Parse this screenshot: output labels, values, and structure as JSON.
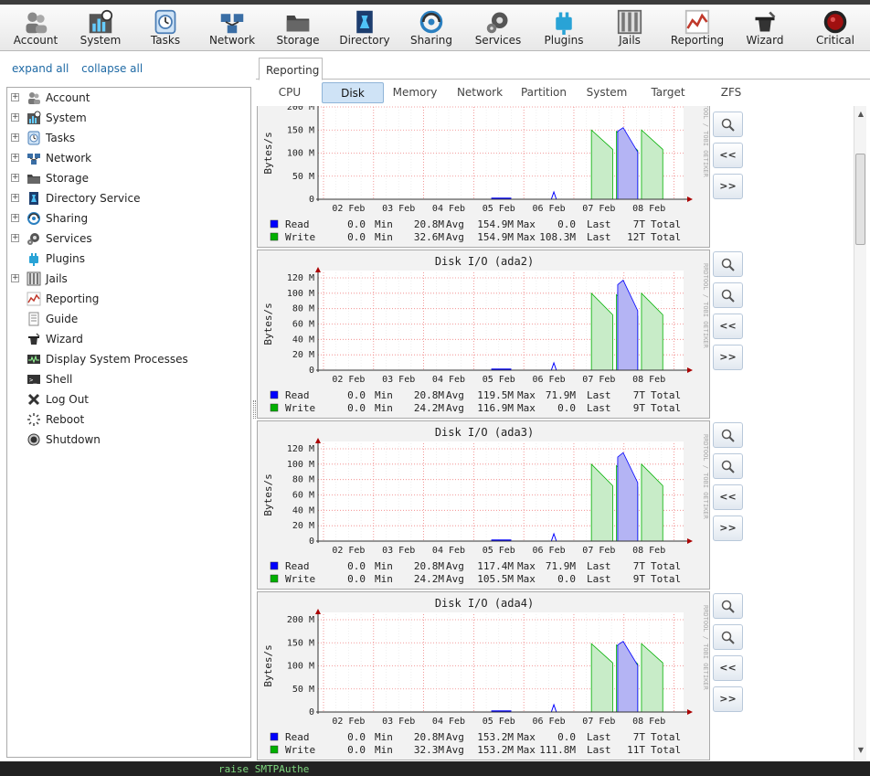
{
  "toolbar": {
    "items": [
      {
        "label": "Account",
        "icon": "users-icon"
      },
      {
        "label": "System",
        "icon": "system-icon"
      },
      {
        "label": "Tasks",
        "icon": "tasks-icon"
      },
      {
        "label": "Network",
        "icon": "network-icon"
      },
      {
        "label": "Storage",
        "icon": "storage-icon"
      },
      {
        "label": "Directory",
        "icon": "directory-icon"
      },
      {
        "label": "Sharing",
        "icon": "sharing-icon"
      },
      {
        "label": "Services",
        "icon": "services-icon"
      },
      {
        "label": "Plugins",
        "icon": "plugins-icon"
      },
      {
        "label": "Jails",
        "icon": "jails-icon"
      },
      {
        "label": "Reporting",
        "icon": "reporting-icon"
      },
      {
        "label": "Wizard",
        "icon": "wizard-icon"
      },
      {
        "label": "Critical",
        "icon": "alert-icon"
      }
    ]
  },
  "tree_controls": {
    "expand": "expand all",
    "collapse": "collapse all"
  },
  "tree": {
    "items": [
      {
        "label": "Account",
        "expandable": true,
        "icon": "users-icon"
      },
      {
        "label": "System",
        "expandable": true,
        "icon": "system-icon"
      },
      {
        "label": "Tasks",
        "expandable": true,
        "icon": "tasks-icon"
      },
      {
        "label": "Network",
        "expandable": true,
        "icon": "network-icon"
      },
      {
        "label": "Storage",
        "expandable": true,
        "icon": "storage-icon"
      },
      {
        "label": "Directory Service",
        "expandable": true,
        "icon": "directory-icon"
      },
      {
        "label": "Sharing",
        "expandable": true,
        "icon": "sharing-icon"
      },
      {
        "label": "Services",
        "expandable": true,
        "icon": "services-icon"
      },
      {
        "label": "Plugins",
        "expandable": false,
        "icon": "plugins-icon"
      },
      {
        "label": "Jails",
        "expandable": true,
        "icon": "jails-icon"
      },
      {
        "label": "Reporting",
        "expandable": false,
        "icon": "reporting-icon"
      },
      {
        "label": "Guide",
        "expandable": false,
        "icon": "guide-icon"
      },
      {
        "label": "Wizard",
        "expandable": false,
        "icon": "wizard-icon"
      },
      {
        "label": "Display System Processes",
        "expandable": false,
        "icon": "processes-icon"
      },
      {
        "label": "Shell",
        "expandable": false,
        "icon": "shell-icon"
      },
      {
        "label": "Log Out",
        "expandable": false,
        "icon": "logout-icon"
      },
      {
        "label": "Reboot",
        "expandable": false,
        "icon": "reboot-icon"
      },
      {
        "label": "Shutdown",
        "expandable": false,
        "icon": "shutdown-icon"
      }
    ]
  },
  "main_tab": "Reporting",
  "subtabs": [
    "CPU",
    "Disk",
    "Memory",
    "Network",
    "Partition",
    "System",
    "Target",
    "ZFS"
  ],
  "active_subtab": "Disk",
  "nav_buttons": {
    "zoom_in": "+",
    "zoom_out": "−",
    "back": "<<",
    "forward": ">>"
  },
  "status": {
    "text": "raise SMTPAuthe"
  },
  "colors": {
    "read": "#0000ff",
    "write": "#00b000",
    "read_fill": "#b4b4f4",
    "write_fill": "#c8ecc8"
  },
  "chart_data": [
    {
      "type": "area",
      "title": "",
      "ylabel": "Bytes/s",
      "watermark": "RRDTOOL / TOBI OETIKER",
      "x_ticks": [
        "02 Feb",
        "03 Feb",
        "04 Feb",
        "05 Feb",
        "06 Feb",
        "07 Feb",
        "08 Feb"
      ],
      "y_ticks": [
        "0",
        "50 M",
        "100 M",
        "150 M",
        "200 M"
      ],
      "ylim": [
        0,
        200
      ],
      "y_unit": "M",
      "peak_write": 150,
      "peak_read": 155,
      "legend": [
        {
          "name": "Read",
          "min": "0.0",
          "avg": "20.8M",
          "max": "154.9M",
          "last": "0.0",
          "total": "7T"
        },
        {
          "name": "Write",
          "min": "0.0",
          "avg": "32.6M",
          "max": "154.9M",
          "last": "108.3M",
          "total": "12T"
        }
      ]
    },
    {
      "type": "area",
      "title": "Disk I/O (ada2)",
      "ylabel": "Bytes/s",
      "watermark": "RRDTOOL / TOBI OETIKER",
      "x_ticks": [
        "02 Feb",
        "03 Feb",
        "04 Feb",
        "05 Feb",
        "06 Feb",
        "07 Feb",
        "08 Feb"
      ],
      "y_ticks": [
        "0",
        "20 M",
        "40 M",
        "60 M",
        "80 M",
        "100 M",
        "120 M"
      ],
      "ylim": [
        0,
        120
      ],
      "y_unit": "M",
      "peak_write": 100,
      "peak_read": 117,
      "legend": [
        {
          "name": "Read",
          "min": "0.0",
          "avg": "20.8M",
          "max": "119.5M",
          "last": "71.9M",
          "total": "7T"
        },
        {
          "name": "Write",
          "min": "0.0",
          "avg": "24.2M",
          "max": "116.9M",
          "last": "0.0",
          "total": "9T"
        }
      ]
    },
    {
      "type": "area",
      "title": "Disk I/O (ada3)",
      "ylabel": "Bytes/s",
      "watermark": "RRDTOOL / TOBI OETIKER",
      "x_ticks": [
        "02 Feb",
        "03 Feb",
        "04 Feb",
        "05 Feb",
        "06 Feb",
        "07 Feb",
        "08 Feb"
      ],
      "y_ticks": [
        "0",
        "20 M",
        "40 M",
        "60 M",
        "80 M",
        "100 M",
        "120 M"
      ],
      "ylim": [
        0,
        120
      ],
      "y_unit": "M",
      "peak_write": 100,
      "peak_read": 115,
      "legend": [
        {
          "name": "Read",
          "min": "0.0",
          "avg": "20.8M",
          "max": "117.4M",
          "last": "71.9M",
          "total": "7T"
        },
        {
          "name": "Write",
          "min": "0.0",
          "avg": "24.2M",
          "max": "105.5M",
          "last": "0.0",
          "total": "9T"
        }
      ]
    },
    {
      "type": "area",
      "title": "Disk I/O (ada4)",
      "ylabel": "Bytes/s",
      "watermark": "RRDTOOL / TOBI OETIKER",
      "x_ticks": [
        "02 Feb",
        "03 Feb",
        "04 Feb",
        "05 Feb",
        "06 Feb",
        "07 Feb",
        "08 Feb"
      ],
      "y_ticks": [
        "0",
        "50 M",
        "100 M",
        "150 M",
        "200 M"
      ],
      "ylim": [
        0,
        200
      ],
      "y_unit": "M",
      "peak_write": 148,
      "peak_read": 153,
      "legend": [
        {
          "name": "Read",
          "min": "0.0",
          "avg": "20.8M",
          "max": "153.2M",
          "last": "0.0",
          "total": "7T"
        },
        {
          "name": "Write",
          "min": "0.0",
          "avg": "32.3M",
          "max": "153.2M",
          "last": "111.8M",
          "total": "11T"
        }
      ]
    }
  ]
}
